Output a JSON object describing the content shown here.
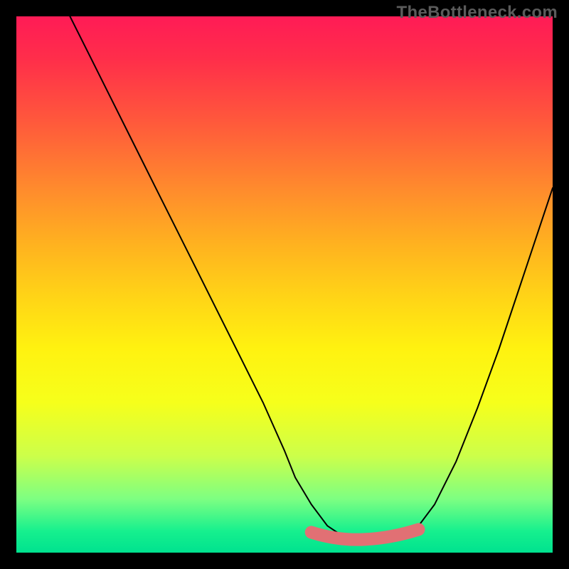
{
  "watermark": "TheBottleneck.com",
  "chart_data": {
    "type": "line",
    "title": "",
    "xlabel": "",
    "ylabel": "",
    "xlim": [
      0,
      100
    ],
    "ylim": [
      0,
      100
    ],
    "grid": false,
    "series": [
      {
        "name": "curve",
        "x": [
          10,
          14,
          18,
          22,
          26,
          30,
          34,
          38,
          42,
          46,
          50,
          52,
          55,
          58,
          61,
          64,
          67,
          70,
          73,
          75,
          78,
          82,
          86,
          90,
          94,
          100
        ],
        "values": [
          100,
          92,
          84,
          76,
          68,
          60,
          52,
          44,
          36,
          28,
          19,
          14,
          9,
          5,
          3,
          2,
          2,
          2,
          3,
          5,
          9,
          17,
          27,
          38,
          50,
          68
        ]
      }
    ],
    "highlight_region": {
      "name": "flat-bottom-highlight",
      "color": "#e17074",
      "x_range": [
        55,
        75
      ],
      "y": 3
    },
    "background_gradient": {
      "top": "#ff1b56",
      "mid": "#fff210",
      "bottom": "#00e28f"
    }
  }
}
